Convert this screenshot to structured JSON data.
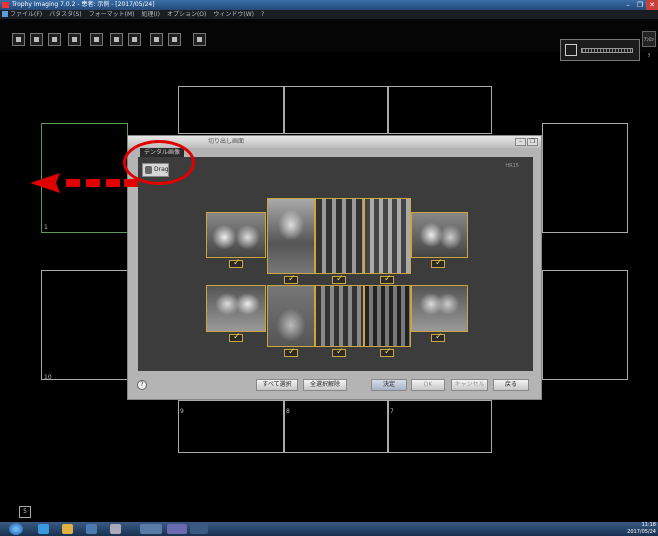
{
  "window": {
    "title": "Trophy Imaging 7.0.2 - 患者: 示例 - [2017/05/24]",
    "controls": [
      "–",
      "❐",
      "✕"
    ]
  },
  "menubar": {
    "items": [
      "ファイル(F)",
      "パタスタ(S)",
      "フォーマット(M)",
      "処理(I)",
      "オプション(O)",
      "ウィンドウ(W)",
      "?"
    ]
  },
  "toolbar": {
    "buttons": [
      "patient-icon",
      "open-icon",
      "import-icon",
      "acquire-icon",
      "scan-icon",
      "xray-icon",
      "layout-icon",
      "print-icon",
      "export-icon",
      "exit-icon"
    ]
  },
  "side_button_label": "ｱﾝﾛｯｸ",
  "frames": {
    "labels": [
      "1",
      "10",
      "9",
      "8",
      "7"
    ]
  },
  "dialog": {
    "title": "切り出し画面",
    "tab": "デンタル画像",
    "drag_label": "Drag",
    "corner_label": "HR15",
    "buttons": {
      "help": "?",
      "select_all": "すべて選択",
      "deselect_all": "全選択解除",
      "confirm": "決定",
      "ok": "OK",
      "cancel": "キャンセル",
      "back": "戻る"
    }
  },
  "page_number": "5",
  "tray": {
    "time": "11:18",
    "date": "2017/05/24"
  },
  "colors": {
    "annotation_red": "#e00000",
    "tile_border": "#c9a640",
    "check": "#f0d040"
  }
}
